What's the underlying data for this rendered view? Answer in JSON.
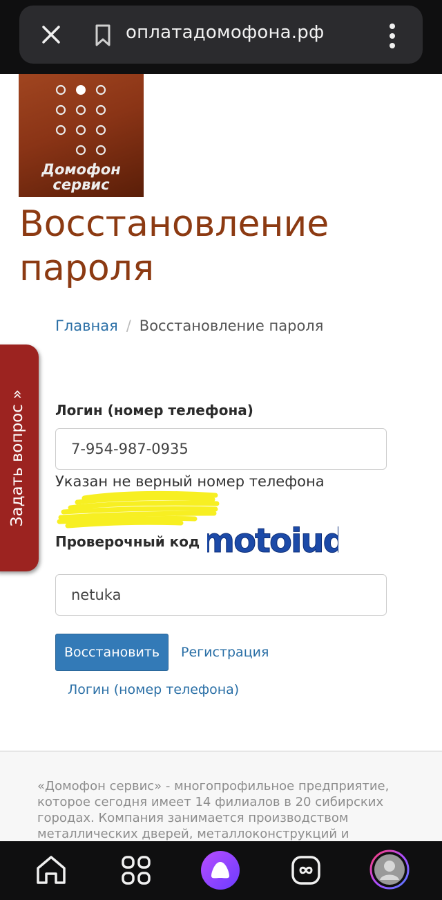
{
  "browser": {
    "url": "оплатадомофона.рф",
    "icons": [
      "close-icon",
      "bookmark-icon",
      "more-icon"
    ]
  },
  "logo": {
    "line1": "Домофон",
    "line2": "сервис"
  },
  "page": {
    "title_line1": "Восстановление",
    "title_line2": "пароля",
    "title_color": "#8c3a12"
  },
  "breadcrumb": {
    "home": "Главная",
    "separator": "/",
    "current": "Восстановление пароля"
  },
  "sidetab": {
    "label": "Задать вопрос »",
    "color": "#9c2320"
  },
  "form": {
    "login_label": "Логин (номер телефона)",
    "login_value": "7-954-987-0935",
    "error_text": "Указан не верный номер телефона",
    "captcha_label": "Проверочный код",
    "captcha_image_text": "motoiud",
    "code_value": "netuka",
    "submit_label": "Восстановить",
    "register_link": "Регистрация",
    "login_link": "Логин (номер телефона)",
    "accent_color": "#337ab7"
  },
  "footer": {
    "text": "«Домофон сервис» - многопрофильное предприятие, которое сегодня имеет 14 филиалов в 20 сибирских городах. Компания занимается производством металлических дверей, металлоконструкций и"
  },
  "bottom_nav": {
    "icons": [
      "home-icon",
      "apps-grid-icon",
      "alice-assistant-icon",
      "infinity-icon",
      "profile-avatar-icon"
    ]
  }
}
